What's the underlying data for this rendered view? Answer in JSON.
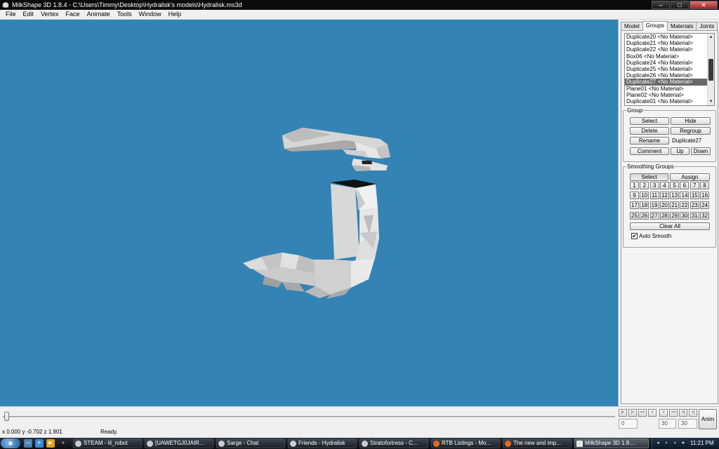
{
  "window": {
    "title": "MilkShape 3D 1.8.4 - C:\\Users\\Timmy\\Desktop\\Hydralisk's models\\Hydralisk.ms3d",
    "icon": "milkshape-app-icon",
    "controls": {
      "minimize": "‒",
      "maximize": "□",
      "close": "✕"
    }
  },
  "menubar": [
    "File",
    "Edit",
    "Vertex",
    "Face",
    "Animate",
    "Tools",
    "Window",
    "Help"
  ],
  "panel": {
    "tabs": [
      "Model",
      "Groups",
      "Materials",
      "Joints"
    ],
    "active_tab": "Groups",
    "groups": [
      "Duplicate20 <No Material>",
      "Duplicate21 <No Material>",
      "Duplicate22 <No Material>",
      "Box06 <No Material>",
      "Duplicate24 <No Material>",
      "Duplicate25 <No Material>",
      "Duplicate26 <No Material>",
      "Duplicate27 <No Material>",
      "Plane01 <No Material>",
      "Plane02 <No Material>",
      "Duplicate01 <No Material>"
    ],
    "selected_group": "Duplicate27 <No Material>",
    "group_box": {
      "legend": "Group",
      "select": "Select",
      "hide": "Hide",
      "delete": "Delete",
      "regroup": "Regroup",
      "rename": "Rename",
      "name_value": "Duplicate27",
      "comment": "Comment",
      "up": "Up",
      "down": "Down"
    },
    "smoothing_box": {
      "legend": "Smoothing Groups",
      "select": "Select",
      "assign": "Assign",
      "numbers": [
        "1",
        "2",
        "3",
        "4",
        "5",
        "6",
        "7",
        "8",
        "9",
        "10",
        "11",
        "12",
        "13",
        "14",
        "15",
        "16",
        "17",
        "18",
        "19",
        "20",
        "21",
        "22",
        "23",
        "24",
        "25",
        "26",
        "27",
        "28",
        "29",
        "30",
        "31",
        "32"
      ],
      "clear_all": "Clear All",
      "auto_smooth_label": "Auto Smooth",
      "auto_smooth_checked": true,
      "check_glyph": "✔"
    }
  },
  "bottom": {
    "coords": "x 0.000 y -0.702 z 1.901",
    "status": "Ready.",
    "anim_button": "Anim",
    "nav_glyphs": [
      "|<",
      "|<",
      "<<",
      "<",
      ">",
      ">>",
      ">|",
      ">|"
    ],
    "frame_fields": [
      "0",
      "30",
      "30"
    ]
  },
  "taskbar": {
    "start": "◉",
    "quick_launch": [
      "show-desktop-icon",
      "ie-icon",
      "media-player-icon"
    ],
    "items": [
      "STEAM - lil_robot",
      "[UAWETGJ0JAIR...",
      "Sarge - Chat",
      "Friends - Hydralisk",
      "Stratofortress - C...",
      "RTB Listings - Mo...",
      "The new and imp...",
      "MilkShape 3D 1.8...."
    ],
    "active_item": "MilkShape 3D 1.8....",
    "clock": "11:21 PM"
  },
  "colors": {
    "viewport_bg": "#3483b5",
    "selection": "#686868",
    "titlebar": "#0b0b0b"
  }
}
